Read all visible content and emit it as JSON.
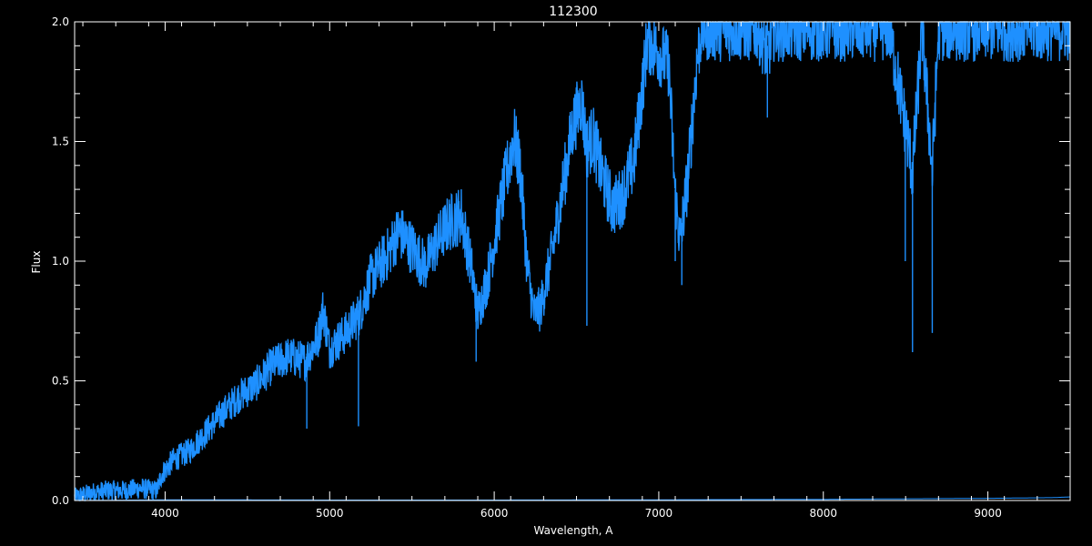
{
  "chart_data": {
    "type": "line",
    "title": "112300",
    "xlabel": "Wavelength, A",
    "ylabel": "Flux",
    "xlim": [
      3450,
      9500
    ],
    "ylim": [
      0.0,
      2.0
    ],
    "x_ticks": [
      4000,
      5000,
      6000,
      7000,
      8000,
      9000
    ],
    "x_tick_labels": [
      "4000",
      "5000",
      "6000",
      "7000",
      "8000",
      "9000"
    ],
    "y_ticks": [
      0.0,
      0.5,
      1.0,
      1.5,
      2.0
    ],
    "y_tick_labels": [
      "0.0",
      "0.5",
      "1.0",
      "1.5",
      "2.0"
    ],
    "grid": false,
    "background": "#000000",
    "axis_color": "#ffffff",
    "series": [
      {
        "color": "#1e90ff",
        "x": [
          3450,
          3550,
          3650,
          3750,
          3850,
          3950,
          3980,
          4050,
          4150,
          4250,
          4350,
          4450,
          4550,
          4650,
          4750,
          4850,
          4930,
          4960,
          5000,
          5100,
          5180,
          5250,
          5350,
          5420,
          5500,
          5580,
          5650,
          5720,
          5800,
          5860,
          5900,
          5960,
          6050,
          6120,
          6160,
          6200,
          6240,
          6280,
          6350,
          6420,
          6480,
          6530,
          6563,
          6600,
          6650,
          6720,
          6780,
          6850,
          6900,
          6930,
          7000,
          7060,
          7100,
          7130,
          7180,
          7230,
          7260,
          7400,
          7600,
          7660,
          7700,
          8000,
          8300,
          8400,
          8498,
          8542,
          8600,
          8662,
          8700,
          8800,
          9000,
          9200,
          9400,
          9500
        ],
        "y": [
          0.02,
          0.04,
          0.05,
          0.05,
          0.06,
          0.05,
          0.12,
          0.18,
          0.22,
          0.3,
          0.38,
          0.45,
          0.5,
          0.58,
          0.62,
          0.6,
          0.7,
          0.82,
          0.65,
          0.72,
          0.8,
          0.95,
          1.05,
          1.15,
          1.08,
          1.0,
          1.1,
          1.18,
          1.22,
          1.0,
          0.8,
          0.95,
          1.3,
          1.55,
          1.4,
          1.0,
          0.8,
          0.82,
          1.05,
          1.35,
          1.6,
          1.7,
          1.5,
          1.55,
          1.4,
          1.25,
          1.3,
          1.45,
          1.75,
          1.95,
          1.9,
          1.85,
          1.3,
          1.1,
          1.4,
          1.85,
          2.0,
          2.0,
          2.0,
          1.9,
          2.0,
          2.0,
          2.0,
          2.0,
          1.6,
          1.4,
          2.0,
          1.4,
          2.0,
          2.0,
          2.0,
          2.0,
          2.0,
          2.0
        ]
      },
      {
        "color": "#1e90ff",
        "x": [
          3450,
          4000,
          5000,
          6000,
          7000,
          8000,
          8500,
          9000,
          9400,
          9500
        ],
        "y": [
          0.0,
          0.003,
          0.002,
          0.002,
          0.003,
          0.005,
          0.007,
          0.009,
          0.012,
          0.015
        ]
      }
    ],
    "absorption_lines": [
      {
        "x": 4861,
        "y": 0.3
      },
      {
        "x": 5175,
        "y": 0.31
      },
      {
        "x": 5890,
        "y": 0.58
      },
      {
        "x": 6563,
        "y": 0.73
      },
      {
        "x": 7100,
        "y": 1.0
      },
      {
        "x": 7140,
        "y": 0.9
      },
      {
        "x": 7660,
        "y": 1.6
      },
      {
        "x": 8498,
        "y": 1.0
      },
      {
        "x": 8542,
        "y": 0.62
      },
      {
        "x": 8662,
        "y": 0.7
      }
    ]
  }
}
